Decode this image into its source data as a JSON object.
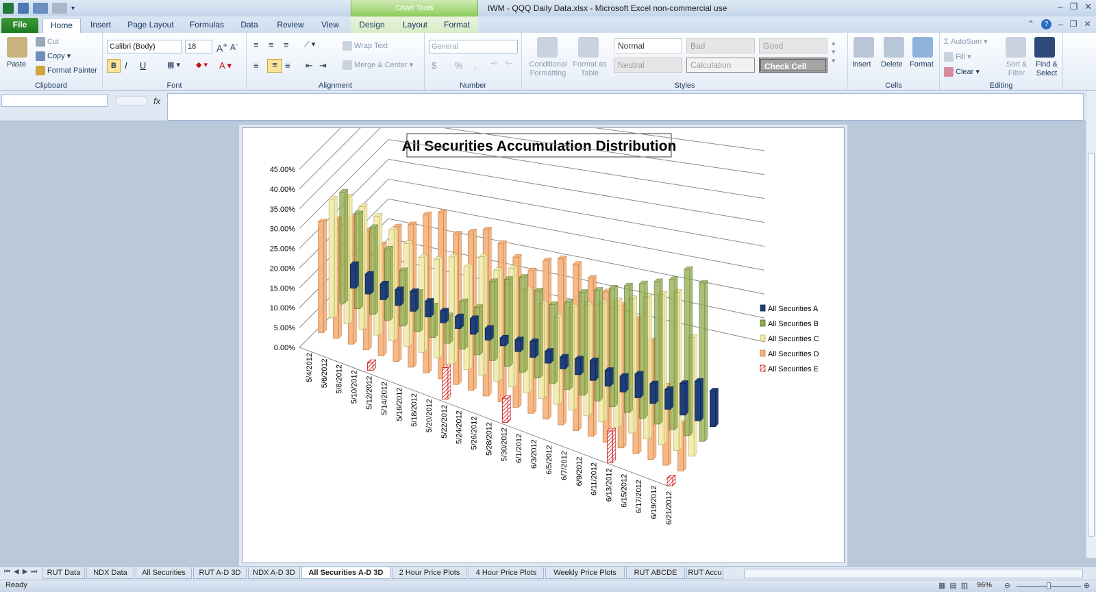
{
  "window": {
    "title": "IWM - QQQ  Daily Data.xlsx  -  Microsoft Excel non-commercial use",
    "context_band": "Chart Tools",
    "controls": [
      "–",
      "❐",
      "✕"
    ]
  },
  "tabs": [
    "File",
    "Home",
    "Insert",
    "Page Layout",
    "Formulas",
    "Data",
    "Review",
    "View"
  ],
  "context_tabs": [
    "Design",
    "Layout",
    "Format"
  ],
  "ribbon": {
    "clipboard": {
      "label": "Clipboard",
      "paste": "Paste",
      "cut": "Cut",
      "copy": "Copy",
      "format_painter": "Format Painter"
    },
    "font": {
      "label": "Font",
      "font_name": "Calibri (Body)",
      "font_size": "18",
      "bold": "B",
      "italic": "I",
      "underline": "U"
    },
    "alignment": {
      "label": "Alignment",
      "wrap_text": "Wrap Text",
      "merge_center": "Merge & Center"
    },
    "number": {
      "label": "Number",
      "format": "General",
      "currency": "$",
      "percent": "%",
      "comma": ","
    },
    "styles": {
      "label": "Styles",
      "conditional": "Conditional Formatting",
      "format_table": "Format as Table",
      "cells": [
        "Normal",
        "Bad",
        "Good",
        "Neutral",
        "Calculation",
        "Check Cell"
      ]
    },
    "cells": {
      "label": "Cells",
      "insert": "Insert",
      "delete": "Delete",
      "format": "Format"
    },
    "editing": {
      "label": "Editing",
      "autosum": "AutoSum",
      "fill": "Fill",
      "clear": "Clear",
      "sort_filter": "Sort & Filter",
      "find_select": "Find & Select"
    }
  },
  "formula_bar": {
    "fx": "fx",
    "name_box": "",
    "value": ""
  },
  "sheet_tabs": [
    "RUT Data",
    "NDX Data",
    "All Securities",
    "RUT A-D 3D",
    "NDX A-D 3D",
    "All Securities A-D 3D",
    "2 Hour Price Plots",
    "4 Hour Price Plots",
    "Weekly Price Plots",
    "RUT ABCDE",
    "RUT Accu"
  ],
  "active_sheet": "All Securities A-D 3D",
  "status": {
    "ready": "Ready",
    "zoom": "96%"
  },
  "colors": {
    "A": "#1f3f7a",
    "B": "#8faa4a",
    "C": "#f2ecaa",
    "D": "#f4b17a",
    "E": "#e03030"
  },
  "chart_data": {
    "type": "bar",
    "title": "All Securities Accumulation Distribution",
    "y_ticks": [
      "45.00%",
      "40.00%",
      "35.00%",
      "30.00%",
      "25.00%",
      "20.00%",
      "15.00%",
      "10.00%",
      "5.00%",
      "0.00%"
    ],
    "ylim": [
      0,
      45
    ],
    "categories": [
      "5/4/2012",
      "5/6/2012",
      "5/8/2012",
      "5/10/2012",
      "5/12/2012",
      "5/14/2012",
      "5/16/2012",
      "5/18/2012",
      "5/20/2012",
      "5/22/2012",
      "5/24/2012",
      "5/26/2012",
      "5/28/2012",
      "5/30/2012",
      "6/1/2012",
      "6/3/2012",
      "6/5/2012",
      "6/7/2012",
      "6/9/2012",
      "6/11/2012",
      "6/13/2012",
      "6/15/2012",
      "6/17/2012",
      "6/19/2012",
      "6/21/2012"
    ],
    "series": [
      {
        "name": "All Securities A",
        "values": [
          6,
          5,
          4,
          4,
          5,
          4,
          3,
          3,
          4,
          3,
          2,
          3,
          4,
          3,
          3,
          4,
          5,
          4,
          4,
          6,
          5,
          5,
          8,
          10,
          9
        ]
      },
      {
        "name": "All Securities B",
        "values": [
          28,
          24,
          22,
          18,
          14,
          10,
          8,
          7,
          12,
          12,
          20,
          22,
          24,
          22,
          20,
          22,
          26,
          28,
          30,
          32,
          34,
          36,
          38,
          42,
          40
        ]
      },
      {
        "name": "All Securities C",
        "values": [
          30,
          32,
          31,
          30,
          28,
          26,
          24,
          25,
          27,
          26,
          30,
          28,
          30,
          26,
          24,
          22,
          26,
          28,
          30,
          32,
          34,
          36,
          38,
          40,
          30
        ]
      },
      {
        "name": "All Securities D",
        "values": [
          28,
          30,
          32,
          30,
          28,
          34,
          36,
          40,
          42,
          38,
          40,
          42,
          40,
          38,
          36,
          40,
          42,
          42,
          40,
          38,
          36,
          34,
          30,
          20,
          12
        ]
      },
      {
        "name": "All Securities E",
        "values": [
          0,
          0,
          0,
          0,
          2,
          0,
          0,
          0,
          0,
          8,
          0,
          0,
          0,
          6,
          0,
          0,
          0,
          0,
          0,
          0,
          8,
          0,
          0,
          0,
          2
        ]
      }
    ],
    "legend": "right"
  }
}
